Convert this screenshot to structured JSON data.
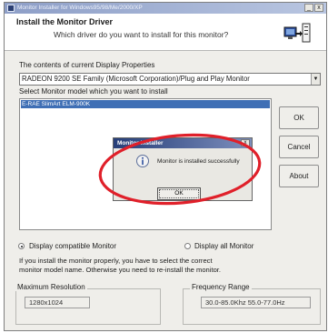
{
  "window": {
    "title": "Monitor Installer for Windows95/98/Me/2000/XP",
    "minimize_glyph": "_",
    "close_glyph": "x"
  },
  "header": {
    "title": "Install the Monitor Driver",
    "subtitle": "Which driver do you want to install for this monitor?",
    "icon": "monitor-install-icon"
  },
  "display_properties": {
    "label": "The contents of current Display Properties",
    "selected_value": "RADEON 9200 SE Family (Microsoft Corporation)/Plug and Play Monitor"
  },
  "model_select": {
    "label": "Select Monitor model which you want to install",
    "items": [
      "E-RAE SlimArt ELM-900K"
    ]
  },
  "buttons": {
    "ok": "OK",
    "cancel": "Cancel",
    "about": "About"
  },
  "radio": {
    "compatible_label": "Display compatible Monitor",
    "all_label": "Display all Monitor",
    "selected": "compatible"
  },
  "info_text": {
    "line1": "If you install the monitor properly, you have to select the correct",
    "line2": "monitor model name. Otherwise you need to re-install the monitor."
  },
  "max_resolution": {
    "label": "Maximum Resolution",
    "value": "1280x1024"
  },
  "frequency_range": {
    "label": "Frequency Range",
    "value": "30.0-85.0Khz 55.0-77.0Hz"
  },
  "dialog": {
    "title": "Monitor Installer",
    "message": "Monitor is installed successfully",
    "ok_label": "OK",
    "close_glyph": "x",
    "icon": "info-icon"
  },
  "colors": {
    "selection": "#3f6fb5",
    "dialog_title": "#273f79",
    "annotation": "#e0202a"
  }
}
